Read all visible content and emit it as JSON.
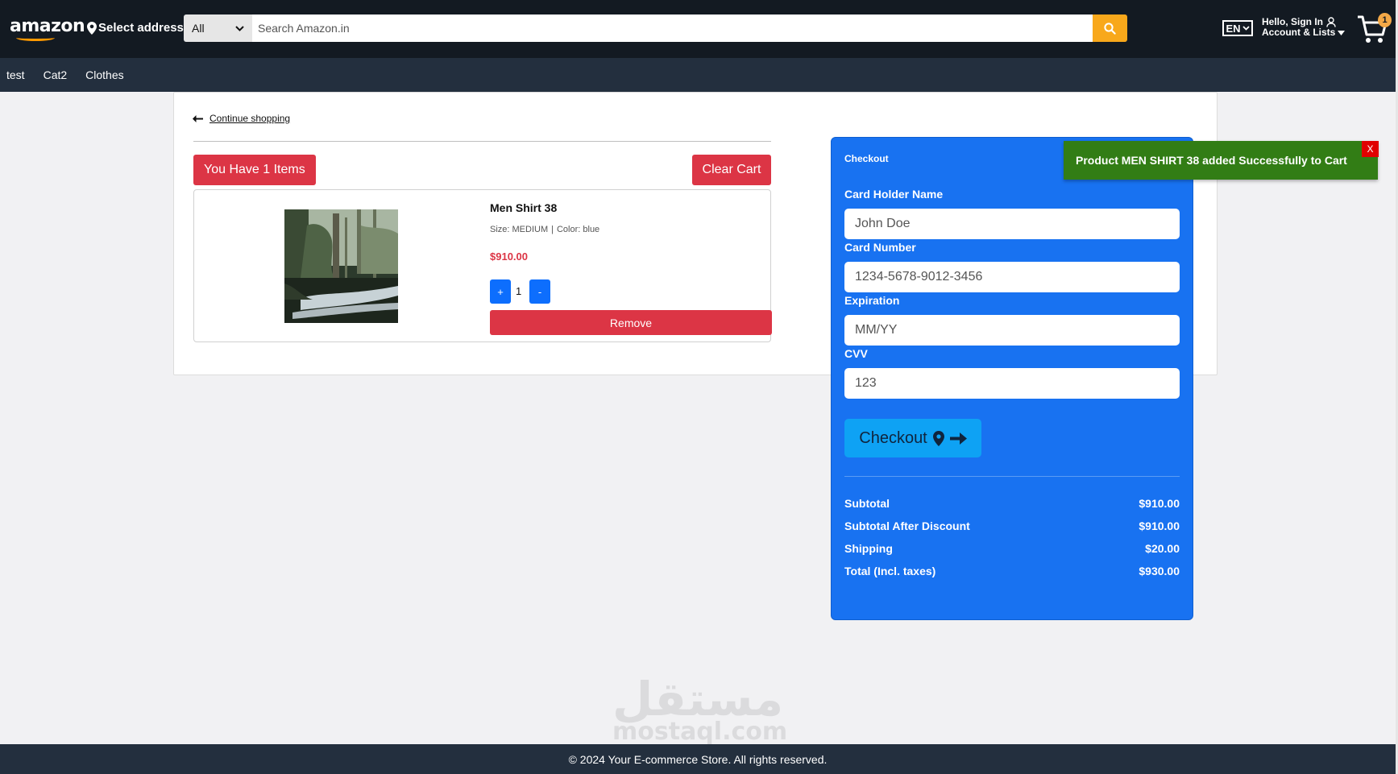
{
  "header": {
    "logo": "amazon",
    "address": "Select address",
    "search_category": "All",
    "search_placeholder": "Search Amazon.in",
    "language": "EN",
    "account_line1": "Hello, Sign In",
    "account_line2": "Account & Lists",
    "cart_count": "1"
  },
  "nav": {
    "items": [
      "test",
      "Cat2",
      "Clothes"
    ]
  },
  "cart": {
    "continue_label": "Continue shopping",
    "items_label": "You Have 1 Items",
    "clear_label": "Clear Cart",
    "item": {
      "name": "Men Shirt 38",
      "size": "Size: MEDIUM",
      "color": "Color: blue",
      "price": "$910.00",
      "plus": "+",
      "minus": "-",
      "quantity": "1",
      "remove_label": "Remove"
    }
  },
  "checkout": {
    "title": "Checkout",
    "card_holder_label": "Card Holder Name",
    "card_holder_placeholder": "John Doe",
    "card_number_label": "Card Number",
    "card_number_placeholder": "1234-5678-9012-3456",
    "expiration_label": "Expiration",
    "expiration_placeholder": "MM/YY",
    "cvv_label": "CVV",
    "cvv_placeholder": "123",
    "button_label": "Checkout",
    "summary": [
      {
        "label": "Subtotal",
        "value": "$910.00"
      },
      {
        "label": "Subtotal After Discount",
        "value": "$910.00"
      },
      {
        "label": "Shipping",
        "value": "$20.00"
      },
      {
        "label": "Total (Incl. taxes)",
        "value": "$930.00"
      }
    ]
  },
  "toast": {
    "message": "Product MEN SHIRT 38 added Successfully to Cart",
    "close": "X"
  },
  "watermark": {
    "arabic": "مستقل",
    "latin": "mostaql.com"
  },
  "footer": {
    "text": "© 2024 Your E-commerce Store. All rights reserved."
  },
  "colors": {
    "header_bg": "#131a22",
    "nav_bg": "#232f3e",
    "danger": "#dc3545",
    "primary": "#0d6efd",
    "checkout_panel": "#1872f1",
    "toast_bg": "#327d15",
    "search_button": "#f8a81b"
  }
}
